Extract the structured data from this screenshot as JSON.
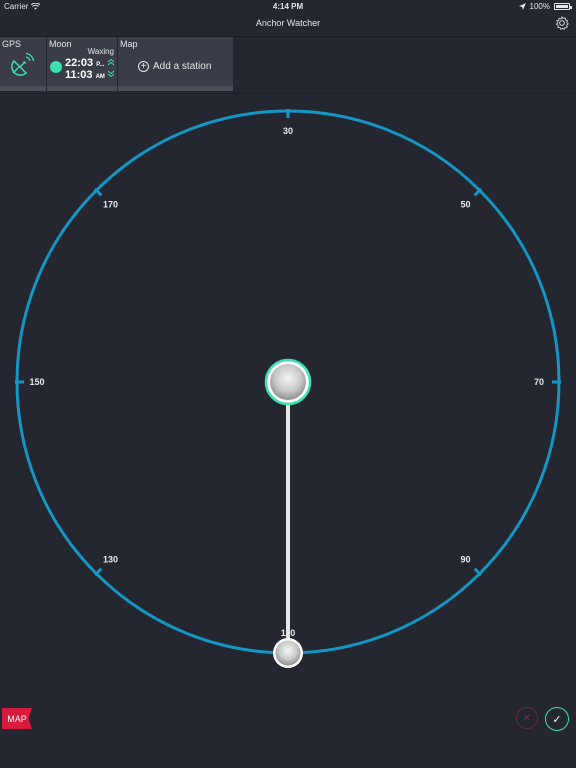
{
  "status": {
    "carrier": "Carrier",
    "time": "4:14 PM",
    "battery": "100%"
  },
  "nav": {
    "title": "Anchor Watcher"
  },
  "cards": {
    "gps": {
      "label": "GPS"
    },
    "moon": {
      "label": "Moon",
      "phase": "Waxing",
      "time1": "22:03",
      "time1_suffix": "P...",
      "time2": "11:03",
      "time2_suffix": "AM"
    },
    "map": {
      "label": "Map",
      "add_station": "Add a station"
    }
  },
  "dial": {
    "labels": [
      {
        "text": "30",
        "angle": 0
      },
      {
        "text": "50",
        "angle": 45
      },
      {
        "text": "70",
        "angle": 90
      },
      {
        "text": "90",
        "angle": 135
      },
      {
        "text": "110",
        "angle": 180
      },
      {
        "text": "130",
        "angle": 225
      },
      {
        "text": "150",
        "angle": 270
      },
      {
        "text": "170",
        "angle": 315
      }
    ],
    "needle_angle": 180
  },
  "actions": {
    "map_label": "MAP",
    "cancel_symbol": "✕",
    "confirm_symbol": "✓"
  },
  "colors": {
    "background": "#252730",
    "ring": "#1596c4",
    "accent": "#3de0b0",
    "map_badge": "#d81b3c"
  }
}
